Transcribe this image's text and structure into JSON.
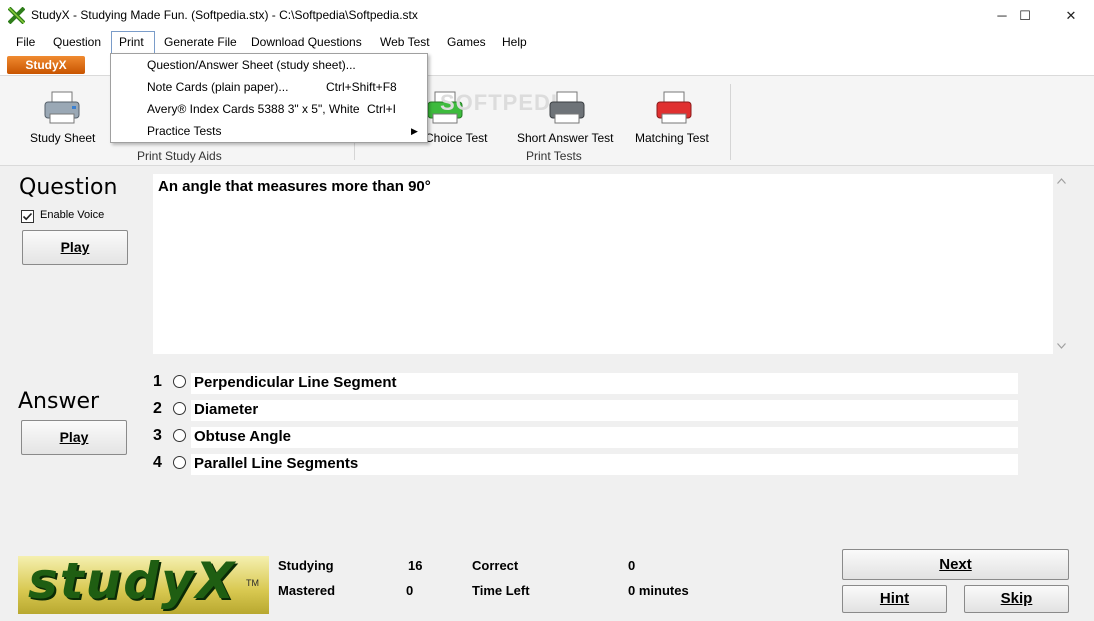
{
  "window": {
    "title": "StudyX - Studying Made Fun. (Softpedia.stx) - C:\\Softpedia\\Softpedia.stx",
    "minimize": "─",
    "maximize": "☐",
    "close": "✕"
  },
  "menubar": {
    "file": "File",
    "question": "Question",
    "print": "Print",
    "generate_file": "Generate File",
    "download_questions": "Download Questions",
    "web_test": "Web Test",
    "games": "Games",
    "help": "Help"
  },
  "ribbon_tab": {
    "label": "StudyX"
  },
  "dropdown": {
    "items": [
      {
        "label": "Question/Answer Sheet (study sheet)...",
        "shortcut": ""
      },
      {
        "label": "Note Cards (plain paper)...",
        "shortcut": "Ctrl+Shift+F8"
      },
      {
        "label": "Avery® Index Cards 5388 3\" x 5\", White",
        "shortcut": "Ctrl+I"
      },
      {
        "label": "Practice Tests",
        "shortcut": "",
        "submenu_arrow": "▶"
      }
    ]
  },
  "ribbon": {
    "study_sheet": "Study Sheet",
    "choice_test": "e Choice Test",
    "short_answer_test": "Short Answer Test",
    "matching_test": "Matching Test",
    "group_print_study_aids": "Print Study Aids",
    "group_print_tests": "Print Tests",
    "watermark": "SOFTPEDIA"
  },
  "question": {
    "title": "Question",
    "enable_voice_label": "Enable Voice",
    "enable_voice_checked": true,
    "play_label": "Play",
    "text": "An angle that measures more than 90°"
  },
  "answer": {
    "title": "Answer",
    "play_label": "Play",
    "options": [
      {
        "num": "1",
        "text": "Perpendicular Line Segment"
      },
      {
        "num": "2",
        "text": "Diameter"
      },
      {
        "num": "3",
        "text": "Obtuse Angle"
      },
      {
        "num": "4",
        "text": "Parallel Line Segments"
      }
    ]
  },
  "stats": {
    "studying_label": "Studying",
    "studying_value": "16",
    "mastered_label": "Mastered",
    "mastered_value": "0",
    "correct_label": "Correct",
    "correct_value": "0",
    "time_left_label": "Time Left",
    "time_left_value": "0 minutes"
  },
  "logo": {
    "text": "studyX",
    "tm": "TM"
  },
  "buttons": {
    "next": "Next",
    "hint": "Hint",
    "skip": "Skip"
  },
  "colors": {
    "accent_orange": "#e06a10",
    "logo_green": "#1f5e12",
    "logo_yellow": "#d8c850"
  }
}
